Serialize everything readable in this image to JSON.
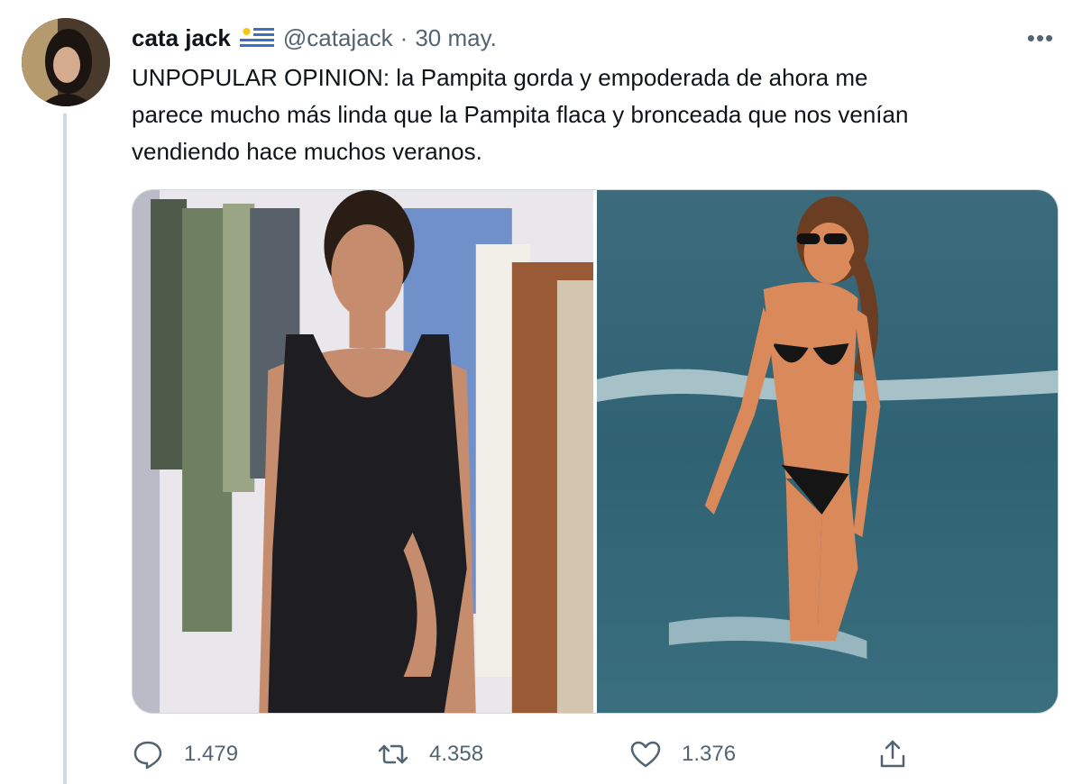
{
  "tweet": {
    "author": {
      "name": "cata jack",
      "handle": "@catajack",
      "flag": "uruguay-flag-icon"
    },
    "separator": "·",
    "date": "30 may.",
    "more_label": "•••",
    "text_lines": [
      "UNPOPULAR OPINION: la Pampita gorda y empoderada de ahora me",
      "parece mucho más linda que la Pampita flaca y bronceada que nos venían",
      "vendiendo hace muchos veranos."
    ]
  },
  "actions": {
    "replies": "1.479",
    "retweets": "4.358",
    "likes": "1.376"
  },
  "colors": {
    "text": "#0f1419",
    "secondary": "#536471",
    "divider": "#cfd9de"
  }
}
